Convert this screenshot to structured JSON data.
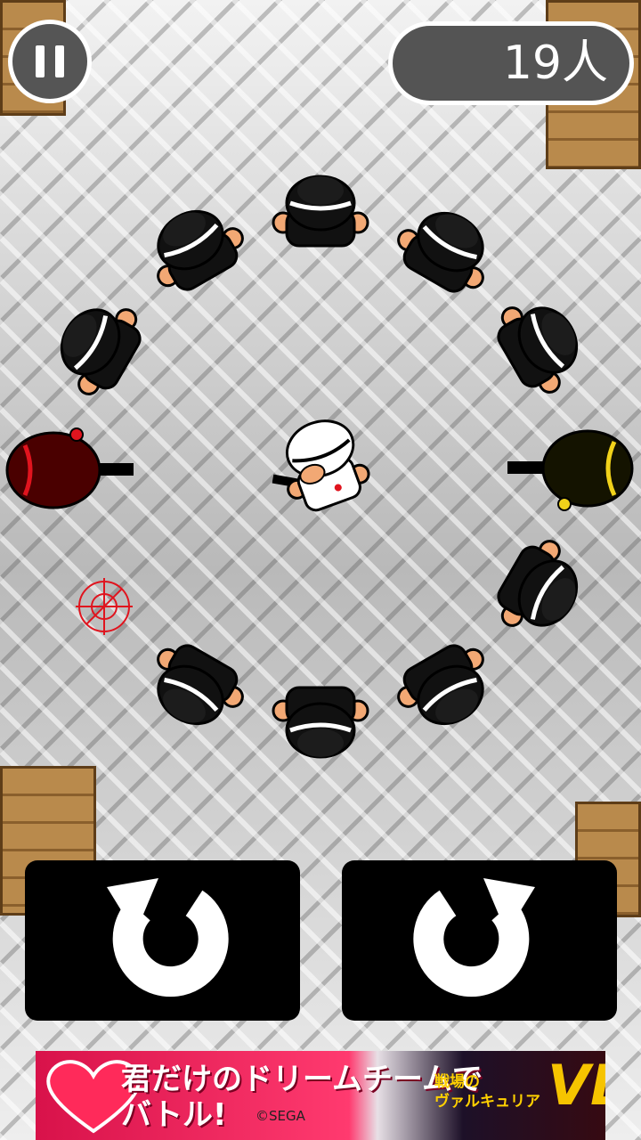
{
  "hud": {
    "pause_icon": "pause-icon",
    "enemy_count": "19人"
  },
  "controls": {
    "rotate_left_icon": "rotate-counterclockwise-icon",
    "rotate_right_icon": "rotate-clockwise-icon"
  },
  "ad": {
    "headline": "君だけのドリームチームで\nバトル!",
    "copyright": "©SEGA",
    "subtitle": "戦場の\nヴァルキュリア",
    "logo": "VD"
  },
  "colors": {
    "enemy": "#111111",
    "red_gunman": "#c8131e",
    "yellow_gunman": "#f1d21a",
    "player": "#ffffff",
    "crosshair": "#e0141e"
  }
}
